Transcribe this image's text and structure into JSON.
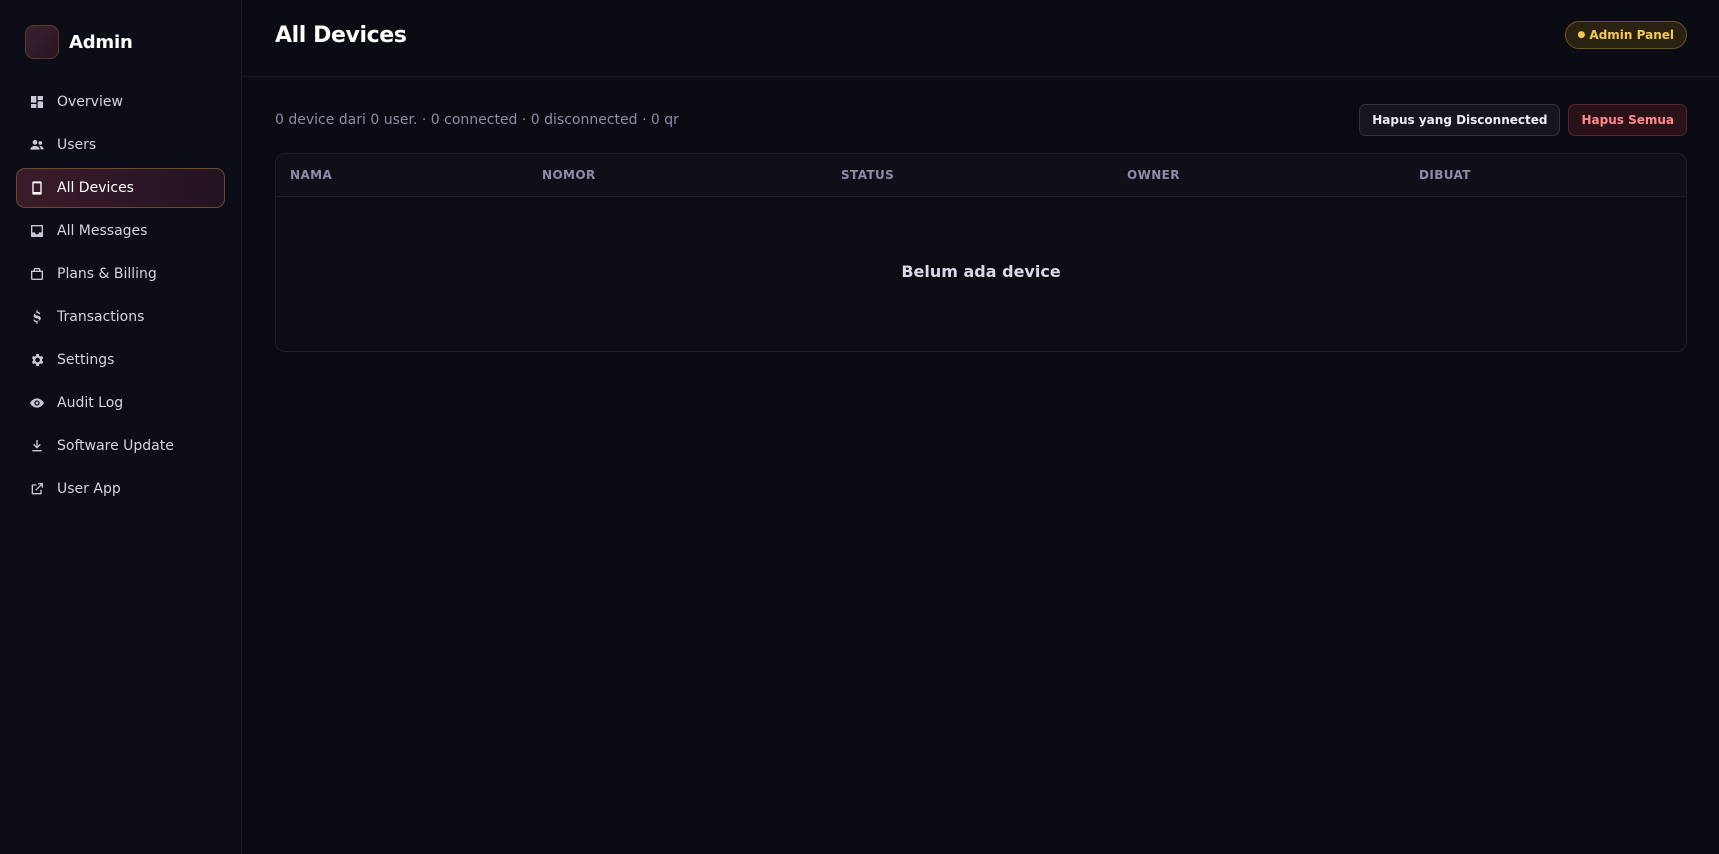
{
  "brand": {
    "name": "Admin"
  },
  "sidebar": {
    "items": [
      {
        "label": "Overview",
        "icon": "dashboard-icon",
        "active": false
      },
      {
        "label": "Users",
        "icon": "users-icon",
        "active": false
      },
      {
        "label": "All Devices",
        "icon": "phone-icon",
        "active": true
      },
      {
        "label": "All Messages",
        "icon": "inbox-icon",
        "active": false
      },
      {
        "label": "Plans & Billing",
        "icon": "briefcase-icon",
        "active": false
      },
      {
        "label": "Transactions",
        "icon": "dollar-icon",
        "active": false
      },
      {
        "label": "Settings",
        "icon": "gear-icon",
        "active": false
      },
      {
        "label": "Audit Log",
        "icon": "eye-icon",
        "active": false
      },
      {
        "label": "Software Update",
        "icon": "download-icon",
        "active": false
      },
      {
        "label": "User App",
        "icon": "external-link-icon",
        "active": false
      }
    ]
  },
  "header": {
    "title": "All Devices",
    "badge": "Admin Panel",
    "badge_dot": "●"
  },
  "toolbar": {
    "summary": "0 device dari 0 user. · 0 connected · 0 disconnected · 0 qr",
    "delete_disconnected_label": "Hapus yang Disconnected",
    "delete_all_label": "Hapus Semua"
  },
  "table": {
    "columns": [
      "NAMA",
      "NOMOR",
      "STATUS",
      "OWNER",
      "DIBUAT"
    ],
    "rows": [],
    "empty_text": "Belum ada device"
  },
  "colors": {
    "background": "#0b0b14",
    "sidebar": "#0d0d17",
    "accent_badge": "#f2c94c",
    "danger": "#ff8a8a"
  }
}
